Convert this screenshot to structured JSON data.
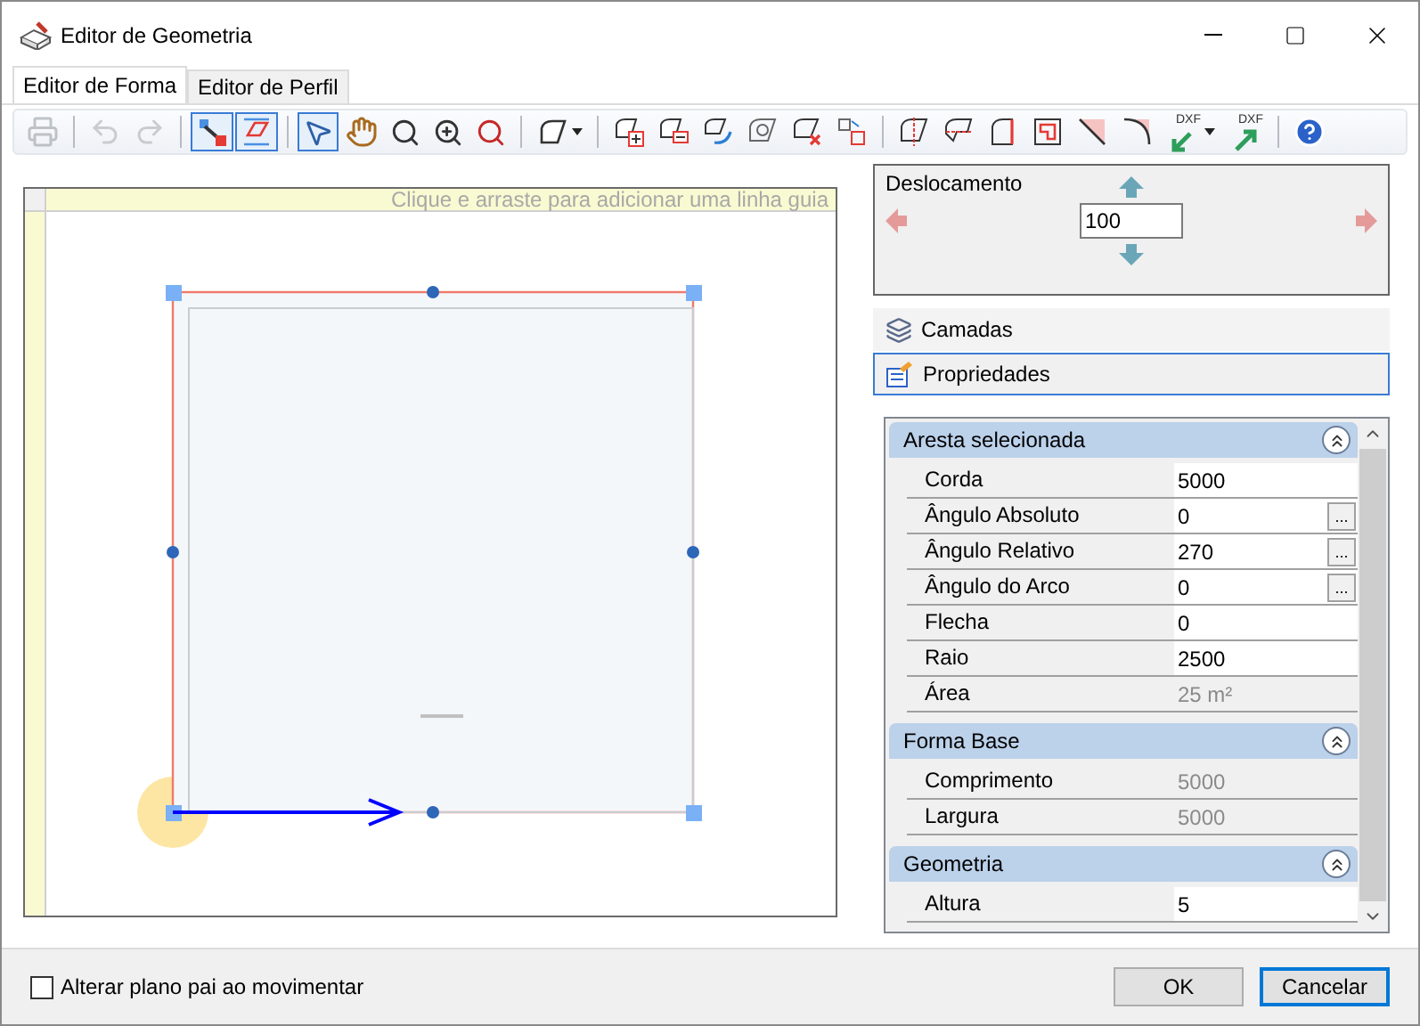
{
  "window": {
    "title": "Editor de Geometria"
  },
  "tabs": [
    {
      "label": "Editor de Forma",
      "selected": true
    },
    {
      "label": "Editor de Perfil",
      "selected": false
    }
  ],
  "toolbar": [
    {
      "kind": "button",
      "disabled": true,
      "pressed": false
    },
    {
      "kind": "separator"
    },
    {
      "kind": "button",
      "disabled": true,
      "pressed": false
    },
    {
      "kind": "button",
      "disabled": true,
      "pressed": false
    },
    {
      "kind": "separator"
    },
    {
      "kind": "button",
      "disabled": false,
      "pressed": true
    },
    {
      "kind": "button",
      "disabled": false,
      "pressed": true
    },
    {
      "kind": "separator"
    },
    {
      "kind": "button",
      "disabled": false,
      "pressed": true
    },
    {
      "kind": "button",
      "disabled": false,
      "pressed": false
    },
    {
      "kind": "button",
      "disabled": false,
      "pressed": false
    },
    {
      "kind": "button",
      "disabled": false,
      "pressed": false
    },
    {
      "kind": "button",
      "disabled": false,
      "pressed": false
    },
    {
      "kind": "separator"
    },
    {
      "kind": "dropdown",
      "disabled": false,
      "pressed": false
    },
    {
      "kind": "separator"
    },
    {
      "kind": "button",
      "disabled": false,
      "pressed": false
    },
    {
      "kind": "button",
      "disabled": false,
      "pressed": false
    },
    {
      "kind": "button",
      "disabled": false,
      "pressed": false
    },
    {
      "kind": "button",
      "disabled": false,
      "pressed": false
    },
    {
      "kind": "button",
      "disabled": false,
      "pressed": false
    },
    {
      "kind": "button",
      "disabled": false,
      "pressed": false
    },
    {
      "kind": "separator"
    },
    {
      "kind": "button",
      "disabled": false,
      "pressed": false
    },
    {
      "kind": "button",
      "disabled": false,
      "pressed": false
    },
    {
      "kind": "button",
      "disabled": false,
      "pressed": false
    },
    {
      "kind": "button",
      "disabled": false,
      "pressed": false
    },
    {
      "kind": "button",
      "disabled": false,
      "pressed": false
    },
    {
      "kind": "button",
      "disabled": false,
      "pressed": false
    },
    {
      "kind": "dropdown",
      "disabled": false,
      "pressed": false,
      "label": "DXF"
    },
    {
      "kind": "button",
      "disabled": false,
      "pressed": false,
      "label": "DXF"
    },
    {
      "kind": "separator"
    },
    {
      "kind": "button",
      "disabled": false,
      "pressed": false
    }
  ],
  "canvas": {
    "hint": "Clique e arraste para adicionar uma linha guia"
  },
  "offset": {
    "title": "Deslocamento",
    "value": "100"
  },
  "panels": [
    {
      "label": "Camadas",
      "selected": false
    },
    {
      "label": "Propriedades",
      "selected": true
    }
  ],
  "properties": [
    {
      "title": "Aresta selecionada",
      "expanded": true,
      "rows": [
        {
          "label": "Corda",
          "value": "5000",
          "readonly": false
        },
        {
          "label": "Ângulo Absoluto",
          "value": "0",
          "readonly": false,
          "button": "..."
        },
        {
          "label": "Ângulo Relativo",
          "value": "270",
          "readonly": false,
          "button": "..."
        },
        {
          "label": "Ângulo do Arco",
          "value": "0",
          "readonly": false,
          "button": "..."
        },
        {
          "label": "Flecha",
          "value": "0",
          "readonly": false
        },
        {
          "label": "Raio",
          "value": "2500",
          "readonly": false
        },
        {
          "label": "Área",
          "value": "25 m²",
          "readonly": true
        }
      ]
    },
    {
      "title": "Forma Base",
      "expanded": true,
      "rows": [
        {
          "label": "Comprimento",
          "value": "5000",
          "readonly": true
        },
        {
          "label": "Largura",
          "value": "5000",
          "readonly": true
        }
      ]
    },
    {
      "title": "Geometria",
      "expanded": true,
      "rows": [
        {
          "label": "Altura",
          "value": "5",
          "readonly": false
        }
      ]
    }
  ],
  "checkbox": {
    "label": "Alterar plano pai ao movimentar",
    "checked": false
  },
  "buttons": [
    {
      "label": "OK",
      "default": false
    },
    {
      "label": "Cancelar",
      "default": true
    }
  ]
}
